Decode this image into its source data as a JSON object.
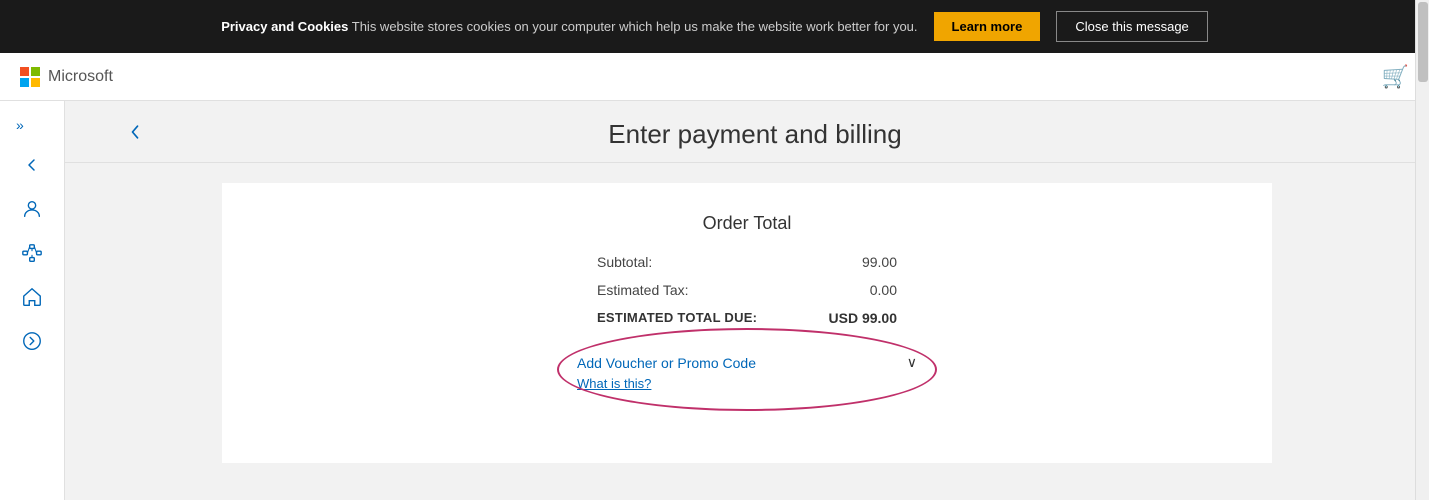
{
  "cookie_banner": {
    "text_bold": "Privacy and Cookies",
    "text_regular": " This website stores cookies on your computer which help us make the website work better for you.",
    "learn_more_label": "Learn more",
    "close_label": "Close this message"
  },
  "header": {
    "logo_text": "Microsoft",
    "cart_icon": "🛒"
  },
  "sidebar": {
    "expand_icon": "»",
    "icons": [
      "←",
      "👤",
      "⊞",
      "🏠",
      "⇒"
    ]
  },
  "page": {
    "back_icon": "←",
    "title": "Enter payment and billing"
  },
  "order": {
    "section_title": "Order Total",
    "subtotal_label": "Subtotal:",
    "subtotal_value": "99.00",
    "tax_label": "Estimated Tax:",
    "tax_value": "0.00",
    "total_label": "ESTIMATED TOTAL DUE:",
    "total_value": "USD 99.00"
  },
  "promo": {
    "add_voucher_label": "Add Voucher or Promo Code",
    "what_is_this_label": "What is this?",
    "chevron": "∨"
  }
}
